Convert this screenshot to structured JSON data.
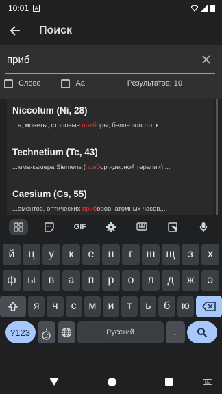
{
  "status_bar": {
    "time": "10:01",
    "app_letter": "A"
  },
  "toolbar": {
    "title": "Поиск"
  },
  "search": {
    "value": "приб"
  },
  "options": {
    "word_label": "Слово",
    "case_label": "Aa",
    "results_label": "Результатов: 10"
  },
  "results": [
    {
      "name": "Niccolum (Ni, 28)",
      "before": "...ь, монеты, столовые ",
      "match": "приб",
      "after": "оры, белое золото, к..."
    },
    {
      "name": "Technetium (Tc, 43)",
      "before": "...мма-камера Siemens (",
      "match": "приб",
      "after": "ор ядерной терапии)...."
    },
    {
      "name": "Caesium (Cs, 55)",
      "before": "...ементов, оптических ",
      "match": "приб",
      "after": "оров, атомных часов,..."
    }
  ],
  "keyboard": {
    "toolbar": {
      "gif_label": "GIF"
    },
    "row1": [
      "й",
      "ц",
      "у",
      "к",
      "е",
      "н",
      "г",
      "ш",
      "щ",
      "з",
      "х"
    ],
    "row2": [
      "ф",
      "ы",
      "в",
      "а",
      "п",
      "р",
      "о",
      "л",
      "д",
      "ж",
      "э"
    ],
    "row3": [
      "я",
      "ч",
      "с",
      "м",
      "и",
      "т",
      "ь",
      "б",
      "ю"
    ],
    "num_label": "?123",
    "emoji_sub": ",",
    "space_label": "Русский",
    "period_label": "."
  },
  "colors": {
    "highlight": "#e53935",
    "accent_key": "#a8c7fa"
  }
}
